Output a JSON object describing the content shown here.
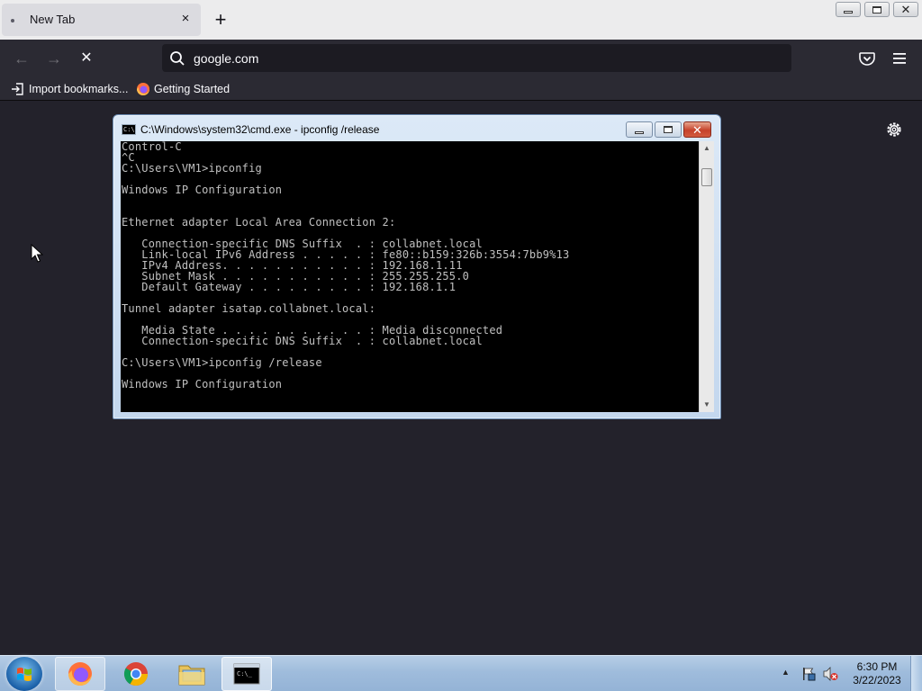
{
  "browser": {
    "tab": {
      "title": "New Tab",
      "close": "×"
    },
    "new_tab": "+",
    "nav": {
      "back": "←",
      "forward": "→",
      "stop": "✕"
    },
    "url": "google.com",
    "bookmarks": [
      {
        "label": "Import bookmarks...",
        "icon": "import-icon"
      },
      {
        "label": "Getting Started",
        "icon": "firefox-icon"
      }
    ]
  },
  "cmd": {
    "title": "C:\\Windows\\system32\\cmd.exe - ipconfig  /release",
    "icon_text": "C:\\",
    "lines": [
      "Control-C",
      "^C",
      "C:\\Users\\VM1>ipconfig",
      "",
      "Windows IP Configuration",
      "",
      "",
      "Ethernet adapter Local Area Connection 2:",
      "",
      "   Connection-specific DNS Suffix  . : collabnet.local",
      "   Link-local IPv6 Address . . . . . : fe80::b159:326b:3554:7bb9%13",
      "   IPv4 Address. . . . . . . . . . . : 192.168.1.11",
      "   Subnet Mask . . . . . . . . . . . : 255.255.255.0",
      "   Default Gateway . . . . . . . . . : 192.168.1.1",
      "",
      "Tunnel adapter isatap.collabnet.local:",
      "",
      "   Media State . . . . . . . . . . . : Media disconnected",
      "   Connection-specific DNS Suffix  . : collabnet.local",
      "",
      "C:\\Users\\VM1>ipconfig /release",
      "",
      "Windows IP Configuration"
    ]
  },
  "taskbar": {
    "apps": [
      "firefox-icon",
      "chrome-icon",
      "explorer-icon",
      "cmd-icon"
    ],
    "clock": {
      "time": "6:30 PM",
      "date": "3/22/2023"
    }
  }
}
